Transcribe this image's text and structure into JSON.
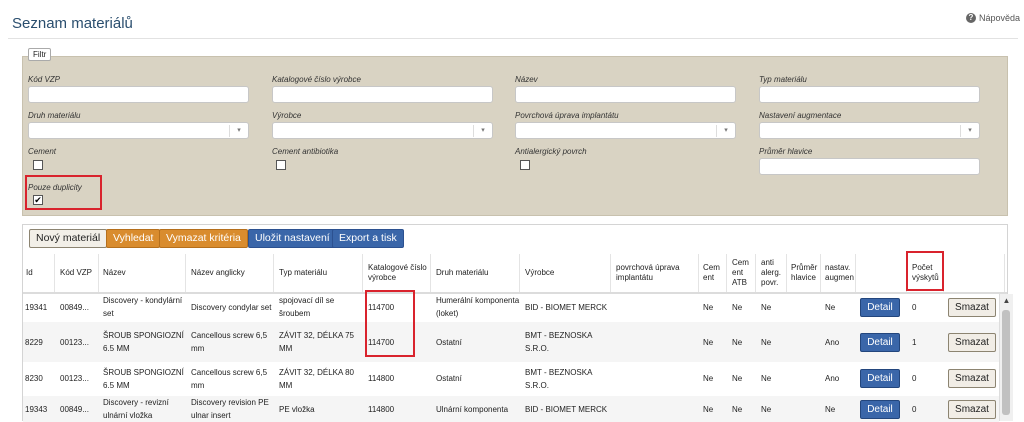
{
  "page": {
    "title": "Seznam materiálů",
    "help_label": "Nápověda",
    "help_icon": "question-circle-icon"
  },
  "filter": {
    "legend": "Filtr",
    "fields": {
      "kod_vzp": "Kód VZP",
      "katalog": "Katalogové číslo výrobce",
      "nazev": "Název",
      "typ": "Typ materiálu",
      "druh": "Druh materiálu",
      "vyrobce": "Výrobce",
      "povrch": "Povrchová úprava implantátu",
      "augment": "Nastavení augmentace",
      "cement": "Cement",
      "cement_atb": "Cement antibiotika",
      "antialerg": "Antialergický povrch",
      "prumer": "Průměr hlavice",
      "duplicity": "Pouze duplicity"
    },
    "duplicity_checked": "✔"
  },
  "toolbar": {
    "new": "Nový materiál",
    "search": "Vyhledat",
    "clear": "Vymazat kritéria",
    "save": "Uložit nastavení",
    "export": "Export a tisk"
  },
  "table": {
    "headers": {
      "id": "Id",
      "kod": "Kód VZP",
      "nazev": "Název",
      "nazev_en": "Název anglicky",
      "typ": "Typ materiálu",
      "katalog": "Katalogové číslo výrobce",
      "druh": "Druh materiálu",
      "vyrobce": "Výrobce",
      "povrch": "povrchová úprava implantátu",
      "cement": "Cem ent",
      "cement_atb": "Cem ent ATB",
      "antialerg": "anti alerg. povr.",
      "prumer": "Průměr hlavice",
      "augment": "nastav. augmen",
      "pocet": "Počet výskytů"
    },
    "detail_label": "Detail",
    "delete_label": "Smazat",
    "rows": [
      {
        "id": "19341",
        "kod": "00849...",
        "nazev": "Discovery - kondylární set",
        "nazev_en": "Discovery condylar set",
        "typ": "spojovací díl se šroubem",
        "katalog": "114700",
        "druh": "Humerální komponenta (loket)",
        "vyrobce": "BID - BIOMET MERCK",
        "povrch": "",
        "cement": "Ne",
        "cement_atb": "Ne",
        "antialerg": "Ne",
        "prumer": "",
        "augment": "Ne",
        "pocet": "0"
      },
      {
        "id": "8229",
        "kod": "00123...",
        "nazev": "ŠROUB SPONGIOZNÍ 6.5 MM",
        "nazev_en": "Cancellous screw 6,5 mm",
        "typ": "ZÁVIT 32, DÉLKA 75 MM",
        "katalog": "114700",
        "druh": "Ostatní",
        "vyrobce": "BMT - BEZNOSKA S.R.O.",
        "povrch": "",
        "cement": "Ne",
        "cement_atb": "Ne",
        "antialerg": "Ne",
        "prumer": "",
        "augment": "Ano",
        "pocet": "1"
      },
      {
        "id": "8230",
        "kod": "00123...",
        "nazev": "ŠROUB SPONGIOZNÍ 6.5 MM",
        "nazev_en": "Cancellous screw 6,5 mm",
        "typ": "ZÁVIT 32, DÉLKA 80 MM",
        "katalog": "114800",
        "druh": "Ostatní",
        "vyrobce": "BMT - BEZNOSKA S.R.O.",
        "povrch": "",
        "cement": "Ne",
        "cement_atb": "Ne",
        "antialerg": "Ne",
        "prumer": "",
        "augment": "Ano",
        "pocet": "0"
      },
      {
        "id": "19343",
        "kod": "00849...",
        "nazev": "Discovery - revizní ulnární vložka",
        "nazev_en": "Discovery revision PE ulnar insert",
        "typ": "PE vložka",
        "katalog": "114800",
        "druh": "Ulnární komponenta",
        "vyrobce": "BID - BIOMET MERCK",
        "povrch": "",
        "cement": "Ne",
        "cement_atb": "Ne",
        "antialerg": "Ne",
        "prumer": "",
        "augment": "Ne",
        "pocet": "0"
      }
    ]
  },
  "colors": {
    "highlight": "#d9232d",
    "filter_bg": "#d9d3c3",
    "primary": "#3a66a9",
    "orange": "#d98c2e",
    "title": "#2a4e6e"
  }
}
